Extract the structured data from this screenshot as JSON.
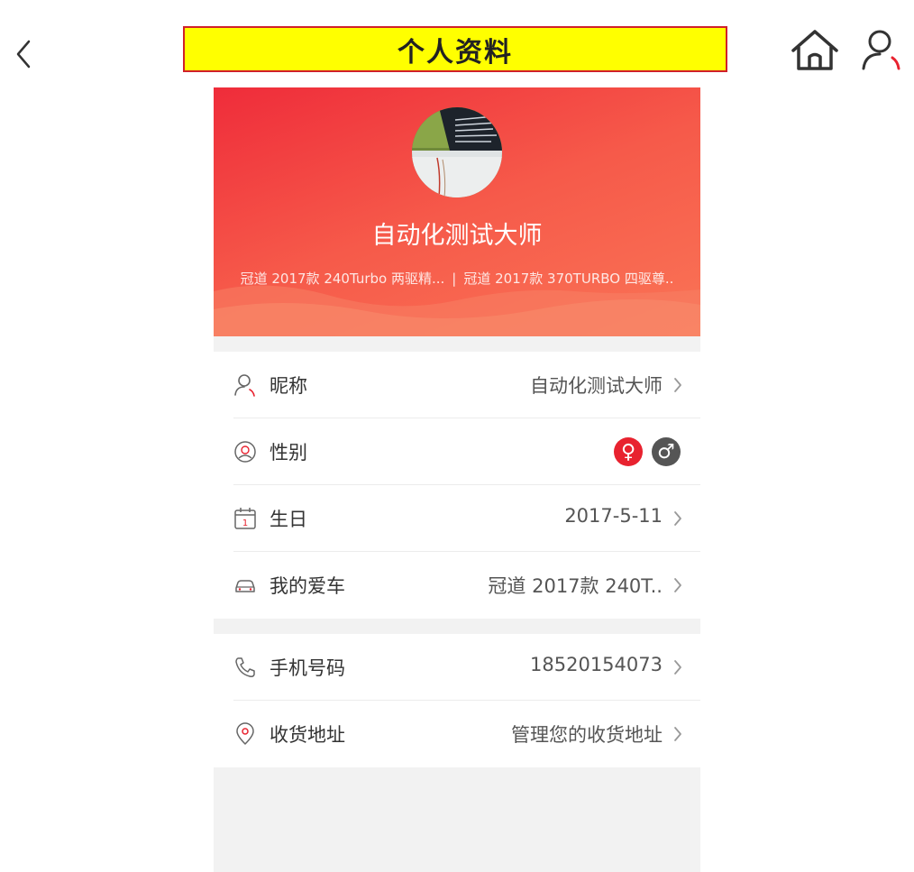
{
  "header": {
    "title": "个人资料"
  },
  "profile": {
    "nickname": "自动化测试大师",
    "car_1": "冠道 2017款 240Turbo 两驱精...",
    "car_sep": "|",
    "car_2": "冠道 2017款 370TURBO 四驱尊.."
  },
  "rows": {
    "nickname": {
      "label": "昵称",
      "value": "自动化测试大师",
      "icon": "user-icon"
    },
    "gender": {
      "label": "性别",
      "female_symbol": "♀",
      "male_symbol": "♂",
      "icon": "gender-icon"
    },
    "birthday": {
      "label": "生日",
      "value": "2017-5-11",
      "icon": "calendar-icon"
    },
    "car": {
      "label": "我的爱车",
      "value": "冠道 2017款 240T..",
      "icon": "car-icon"
    },
    "phone": {
      "label": "手机号码",
      "value": "18520154073",
      "icon": "phone-icon"
    },
    "address": {
      "label": "收货地址",
      "value": "管理您的收货地址",
      "icon": "location-pin-icon"
    }
  },
  "colors": {
    "accent": "#e8222f",
    "title_bg": "#ffff00",
    "page_bg": "#f2f2f2"
  }
}
